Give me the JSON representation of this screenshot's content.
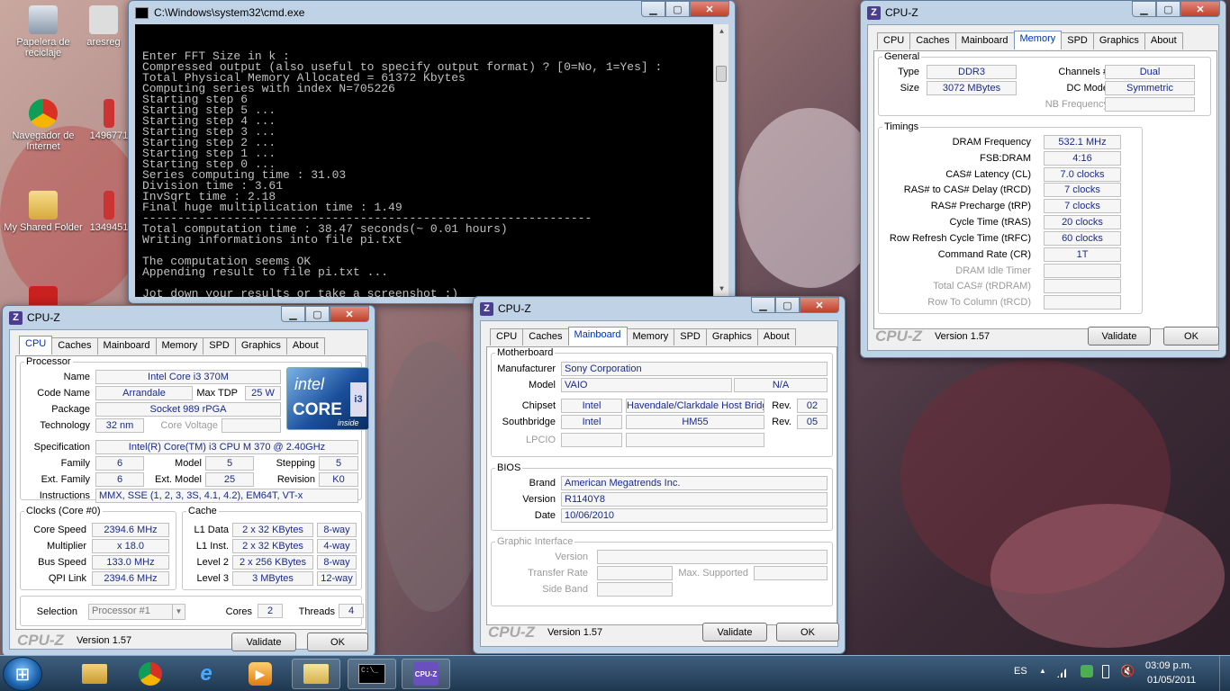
{
  "desktop": {
    "icons": [
      {
        "label": "Papelera de reciclaje"
      },
      {
        "label": "aresreg"
      },
      {
        "label": "Navegador de Internet"
      },
      {
        "label": "1496771"
      },
      {
        "label": "My Shared Folder"
      },
      {
        "label": "1349451"
      }
    ]
  },
  "cmd": {
    "title": "C:\\Windows\\system32\\cmd.exe",
    "text": "Enter FFT Size in k :\nCompressed output (also useful to specify output format) ? [0=No, 1=Yes] :\nTotal Physical Memory Allocated = 61372 Kbytes\nComputing series with index N=705226\nStarting step 6\nStarting step 5 ...\nStarting step 4 ...\nStarting step 3 ...\nStarting step 2 ...\nStarting step 1 ...\nStarting step 0 ...\nSeries computing time : 31.03\nDivision time : 3.61\nInvSqrt time : 2.18\nFinal huge multiplication time : 1.49\n----------------------------------------------------------------\nTotal computation time : 38.47 seconds(~ 0.01 hours)\nWriting informations into file pi.txt\n\nThe computation seems OK\nAppending result to file pi.txt ...\n\nJot down your results or take a screenshot :)\nPresione una tecla para continuar . . ."
  },
  "cpuz_common": {
    "title": "CPU-Z",
    "tabs": [
      "CPU",
      "Caches",
      "Mainboard",
      "Memory",
      "SPD",
      "Graphics",
      "About"
    ],
    "brand": "CPU-Z",
    "version": "Version 1.57",
    "validate": "Validate",
    "ok": "OK"
  },
  "cpu": {
    "processor_legend": "Processor",
    "name_label": "Name",
    "name": "Intel Core i3 370M",
    "codename_label": "Code Name",
    "codename": "Arrandale",
    "maxtdp_label": "Max TDP",
    "maxtdp": "25 W",
    "package_label": "Package",
    "package": "Socket 989 rPGA",
    "tech_label": "Technology",
    "tech": "32 nm",
    "corev_label": "Core Voltage",
    "corev": "",
    "spec_label": "Specification",
    "spec": "Intel(R) Core(TM) i3 CPU       M 370  @ 2.40GHz",
    "family_label": "Family",
    "family": "6",
    "model_label": "Model",
    "model": "5",
    "stepping_label": "Stepping",
    "stepping": "5",
    "extfamily_label": "Ext. Family",
    "extfamily": "6",
    "extmodel_label": "Ext. Model",
    "extmodel": "25",
    "revision_label": "Revision",
    "revision": "K0",
    "instr_label": "Instructions",
    "instr": "MMX, SSE (1, 2, 3, 3S, 4.1, 4.2), EM64T, VT-x",
    "clocks_legend": "Clocks (Core #0)",
    "corespeed_label": "Core Speed",
    "corespeed": "2394.6 MHz",
    "mult_label": "Multiplier",
    "mult": "x 18.0",
    "bus_label": "Bus Speed",
    "bus": "133.0 MHz",
    "qpi_label": "QPI Link",
    "qpi": "2394.6 MHz",
    "cache_legend": "Cache",
    "l1d_label": "L1 Data",
    "l1d": "2 x 32 KBytes",
    "l1d_way": "8-way",
    "l1i_label": "L1 Inst.",
    "l1i": "2 x 32 KBytes",
    "l1i_way": "4-way",
    "l2_label": "Level 2",
    "l2": "2 x 256 KBytes",
    "l2_way": "8-way",
    "l3_label": "Level 3",
    "l3": "3 MBytes",
    "l3_way": "12-way",
    "selection_label": "Selection",
    "selection": "Processor #1",
    "cores_label": "Cores",
    "cores": "2",
    "threads_label": "Threads",
    "threads": "4",
    "logo_top": "intel",
    "logo_main": "CORE",
    "logo_sub": "inside",
    "logo_i": "i3"
  },
  "mainboard": {
    "mb_legend": "Motherboard",
    "manuf_label": "Manufacturer",
    "manuf": "Sony Corporation",
    "model_label": "Model",
    "model": "VAIO",
    "model2": "N/A",
    "chipset_label": "Chipset",
    "chipset_vendor": "Intel",
    "chipset": "Havendale/Clarkdale Host Bridge",
    "chipset_rev_label": "Rev.",
    "chipset_rev": "02",
    "south_label": "Southbridge",
    "south_vendor": "Intel",
    "south": "HM55",
    "south_rev_label": "Rev.",
    "south_rev": "05",
    "lpcio_label": "LPCIO",
    "bios_legend": "BIOS",
    "brand_label": "Brand",
    "brand": "American Megatrends Inc.",
    "version_label": "Version",
    "version": "R1140Y8",
    "date_label": "Date",
    "date": "10/06/2010",
    "gi_legend": "Graphic Interface",
    "gi_version_label": "Version",
    "gi_rate_label": "Transfer Rate",
    "gi_max_label": "Max. Supported",
    "gi_side_label": "Side Band"
  },
  "memory": {
    "general_legend": "General",
    "type_label": "Type",
    "type": "DDR3",
    "size_label": "Size",
    "size": "3072 MBytes",
    "channels_label": "Channels #",
    "channels": "Dual",
    "dcmode_label": "DC Mode",
    "dcmode": "Symmetric",
    "nbfreq_label": "NB Frequency",
    "timings_legend": "Timings",
    "dram_label": "DRAM Frequency",
    "dram": "532.1 MHz",
    "fsb_label": "FSB:DRAM",
    "fsb": "4:16",
    "cl_label": "CAS# Latency (CL)",
    "cl": "7.0 clocks",
    "trcd_label": "RAS# to CAS# Delay (tRCD)",
    "trcd": "7 clocks",
    "trp_label": "RAS# Precharge (tRP)",
    "trp": "7 clocks",
    "tras_label": "Cycle Time (tRAS)",
    "tras": "20 clocks",
    "trfc_label": "Row Refresh Cycle Time (tRFC)",
    "trfc": "60 clocks",
    "cr_label": "Command Rate (CR)",
    "cr": "1T",
    "idle_label": "DRAM Idle Timer",
    "trdram_label": "Total CAS# (tRDRAM)",
    "trcd2_label": "Row To Column (tRCD)"
  },
  "taskbar": {
    "lang": "ES",
    "time": "03:09 p.m.",
    "date": "01/05/2011",
    "cmd_icon": "C:\\_",
    "cpuz_icon": "CPU-Z"
  }
}
